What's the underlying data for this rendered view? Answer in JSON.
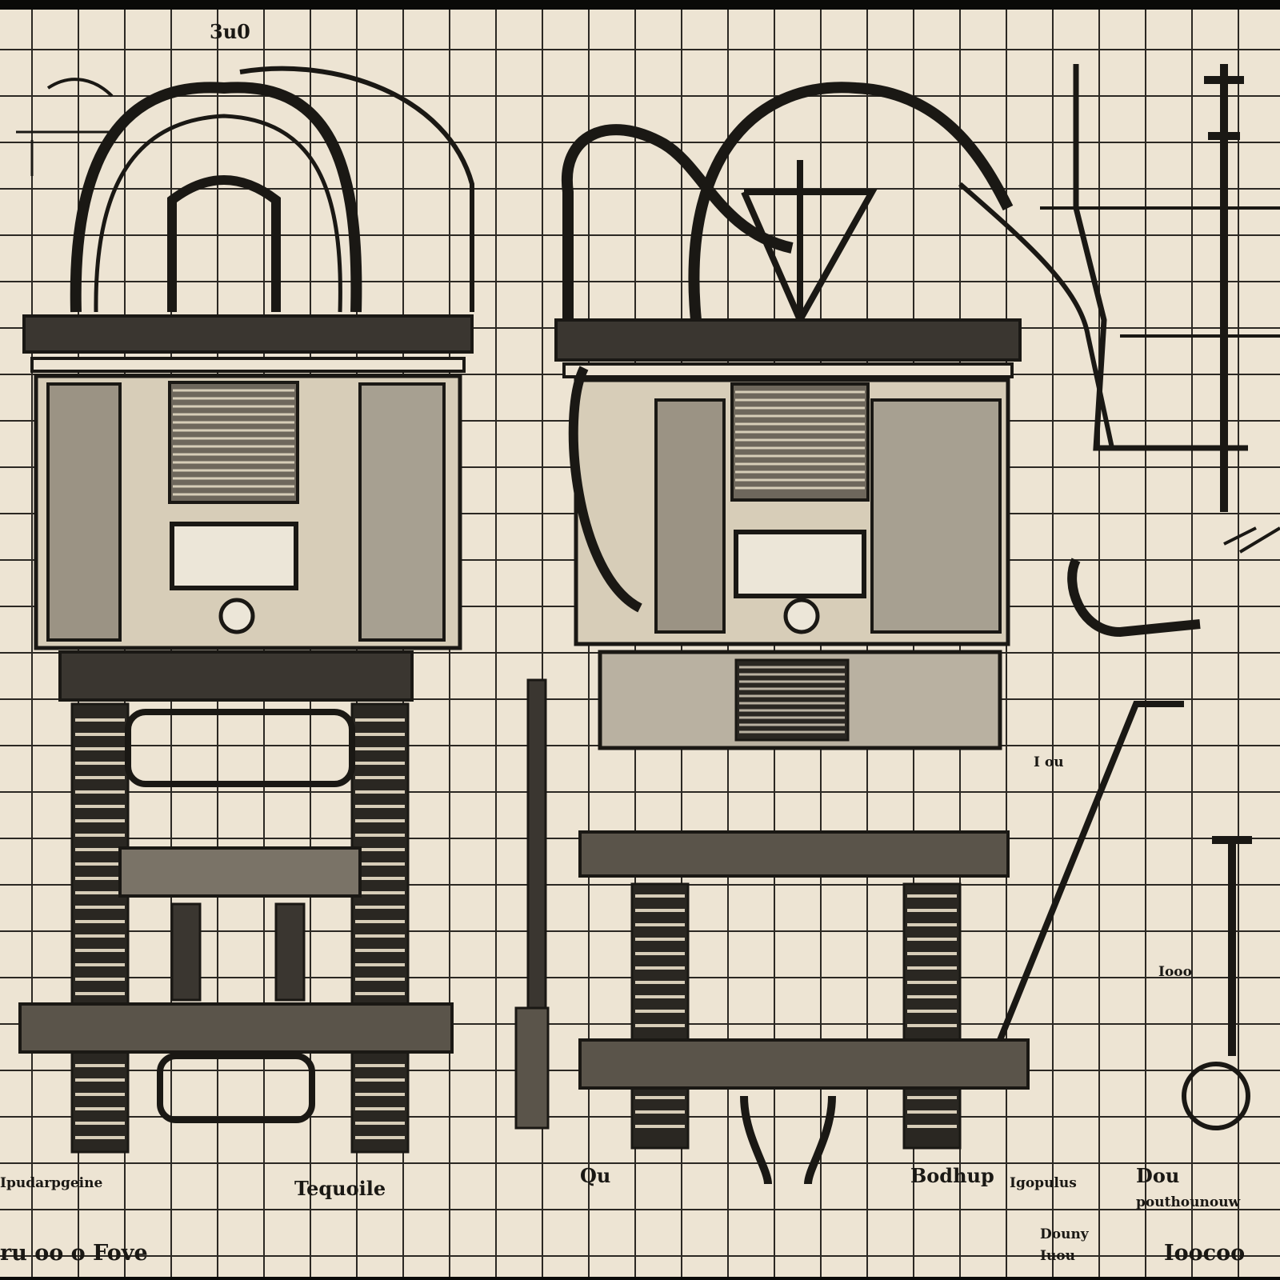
{
  "sheet": {
    "paper_color": "#ede4d3",
    "ink_color": "#1a1814",
    "grid_color": "#2b2823"
  },
  "labels": {
    "top_mark": "3u0",
    "caption_left_1": "Ipudarpgeine",
    "caption_left_2": "Tequoile",
    "caption_mid_1": "Qu",
    "caption_right_1": "Bodhup",
    "caption_right_2": "Igopulus",
    "caption_far_right_1": "Dou",
    "caption_far_right_2": "Douny",
    "caption_far_right_3": "pouthounouw",
    "caption_bottom_left": "ru oo o Fove",
    "caption_bottom_right": "Ioocoo",
    "caption_bottom_mid": "Iuou",
    "side_tag_1": "I ou",
    "side_tag_2": "Iooo"
  }
}
